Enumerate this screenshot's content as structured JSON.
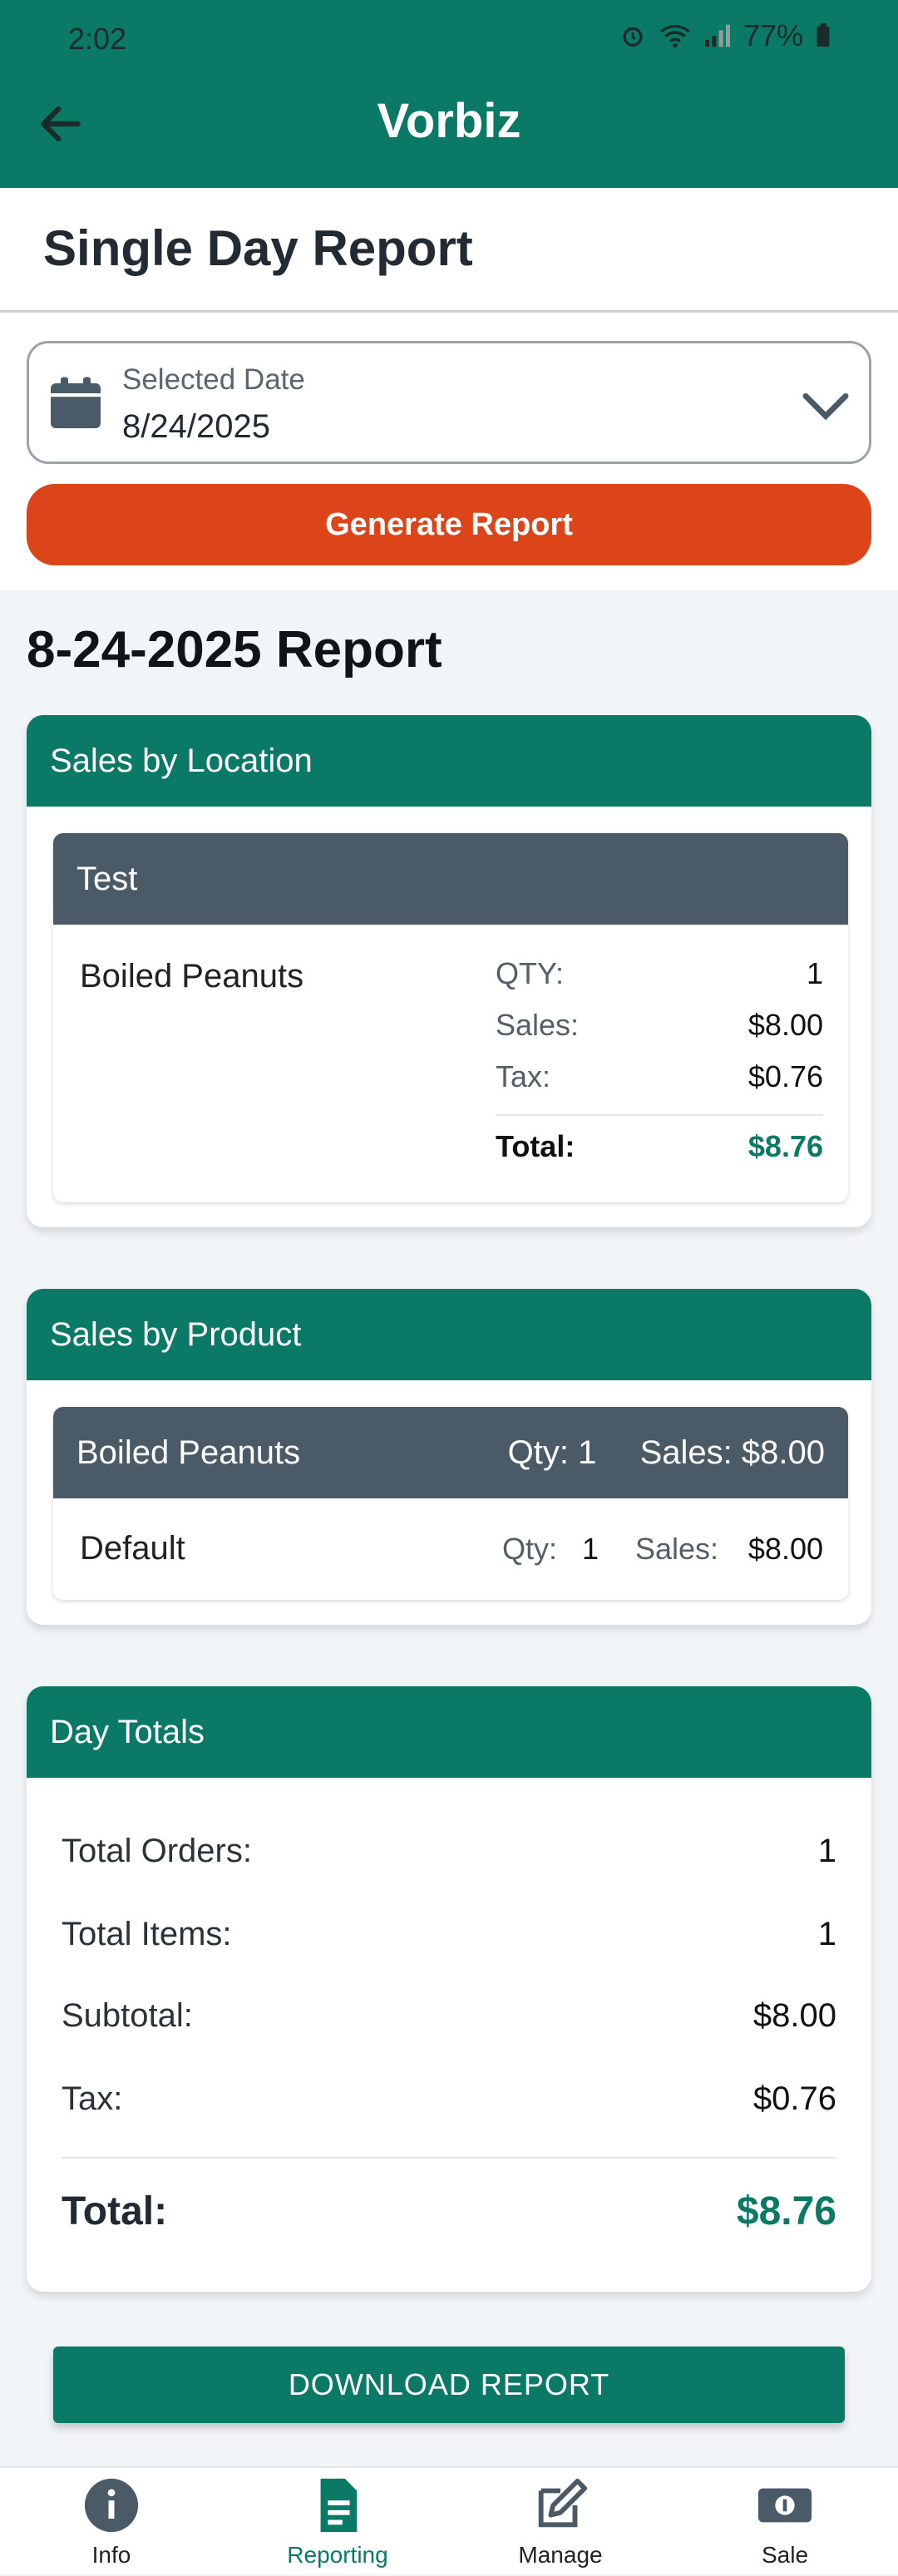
{
  "status_bar": {
    "time": "2:02",
    "battery": "77%"
  },
  "app_bar": {
    "title": "Vorbiz"
  },
  "page": {
    "title": "Single Day Report"
  },
  "date_picker": {
    "label": "Selected Date",
    "value": "8/24/2025"
  },
  "generate_button": {
    "label": "Generate Report"
  },
  "report": {
    "title": "8-24-2025 Report",
    "sales_by_location": {
      "header": "Sales by Location",
      "locations": [
        {
          "name": "Test",
          "product": "Boiled Peanuts",
          "qty_label": "QTY:",
          "qty_value": "1",
          "sales_label": "Sales:",
          "sales_value": "$8.00",
          "tax_label": "Tax:",
          "tax_value": "$0.76",
          "total_label": "Total:",
          "total_value": "$8.76"
        }
      ]
    },
    "sales_by_product": {
      "header": "Sales by Product",
      "products": [
        {
          "name": "Boiled Peanuts",
          "qty": "Qty: 1",
          "sales": "Sales: $8.00",
          "variants": [
            {
              "name": "Default",
              "qty_label": "Qty:",
              "qty_value": "1",
              "sales_label": "Sales:",
              "sales_value": "$8.00"
            }
          ]
        }
      ]
    },
    "day_totals": {
      "header": "Day Totals",
      "total_orders_label": "Total Orders:",
      "total_orders_value": "1",
      "total_items_label": "Total Items:",
      "total_items_value": "1",
      "subtotal_label": "Subtotal:",
      "subtotal_value": "$8.00",
      "tax_label": "Tax:",
      "tax_value": "$0.76",
      "total_label": "Total:",
      "total_value": "$8.76"
    }
  },
  "download_button": {
    "label": "DOWNLOAD REPORT"
  },
  "bottom_nav": {
    "items": [
      {
        "label": "Info",
        "icon": "info-icon"
      },
      {
        "label": "Reporting",
        "icon": "report-icon",
        "active": true
      },
      {
        "label": "Manage",
        "icon": "edit-icon"
      },
      {
        "label": "Sale",
        "icon": "cash-icon"
      }
    ]
  },
  "colors": {
    "primary": "#0a7a66",
    "accent": "#dc4519",
    "dark_header": "#4a5a66"
  }
}
